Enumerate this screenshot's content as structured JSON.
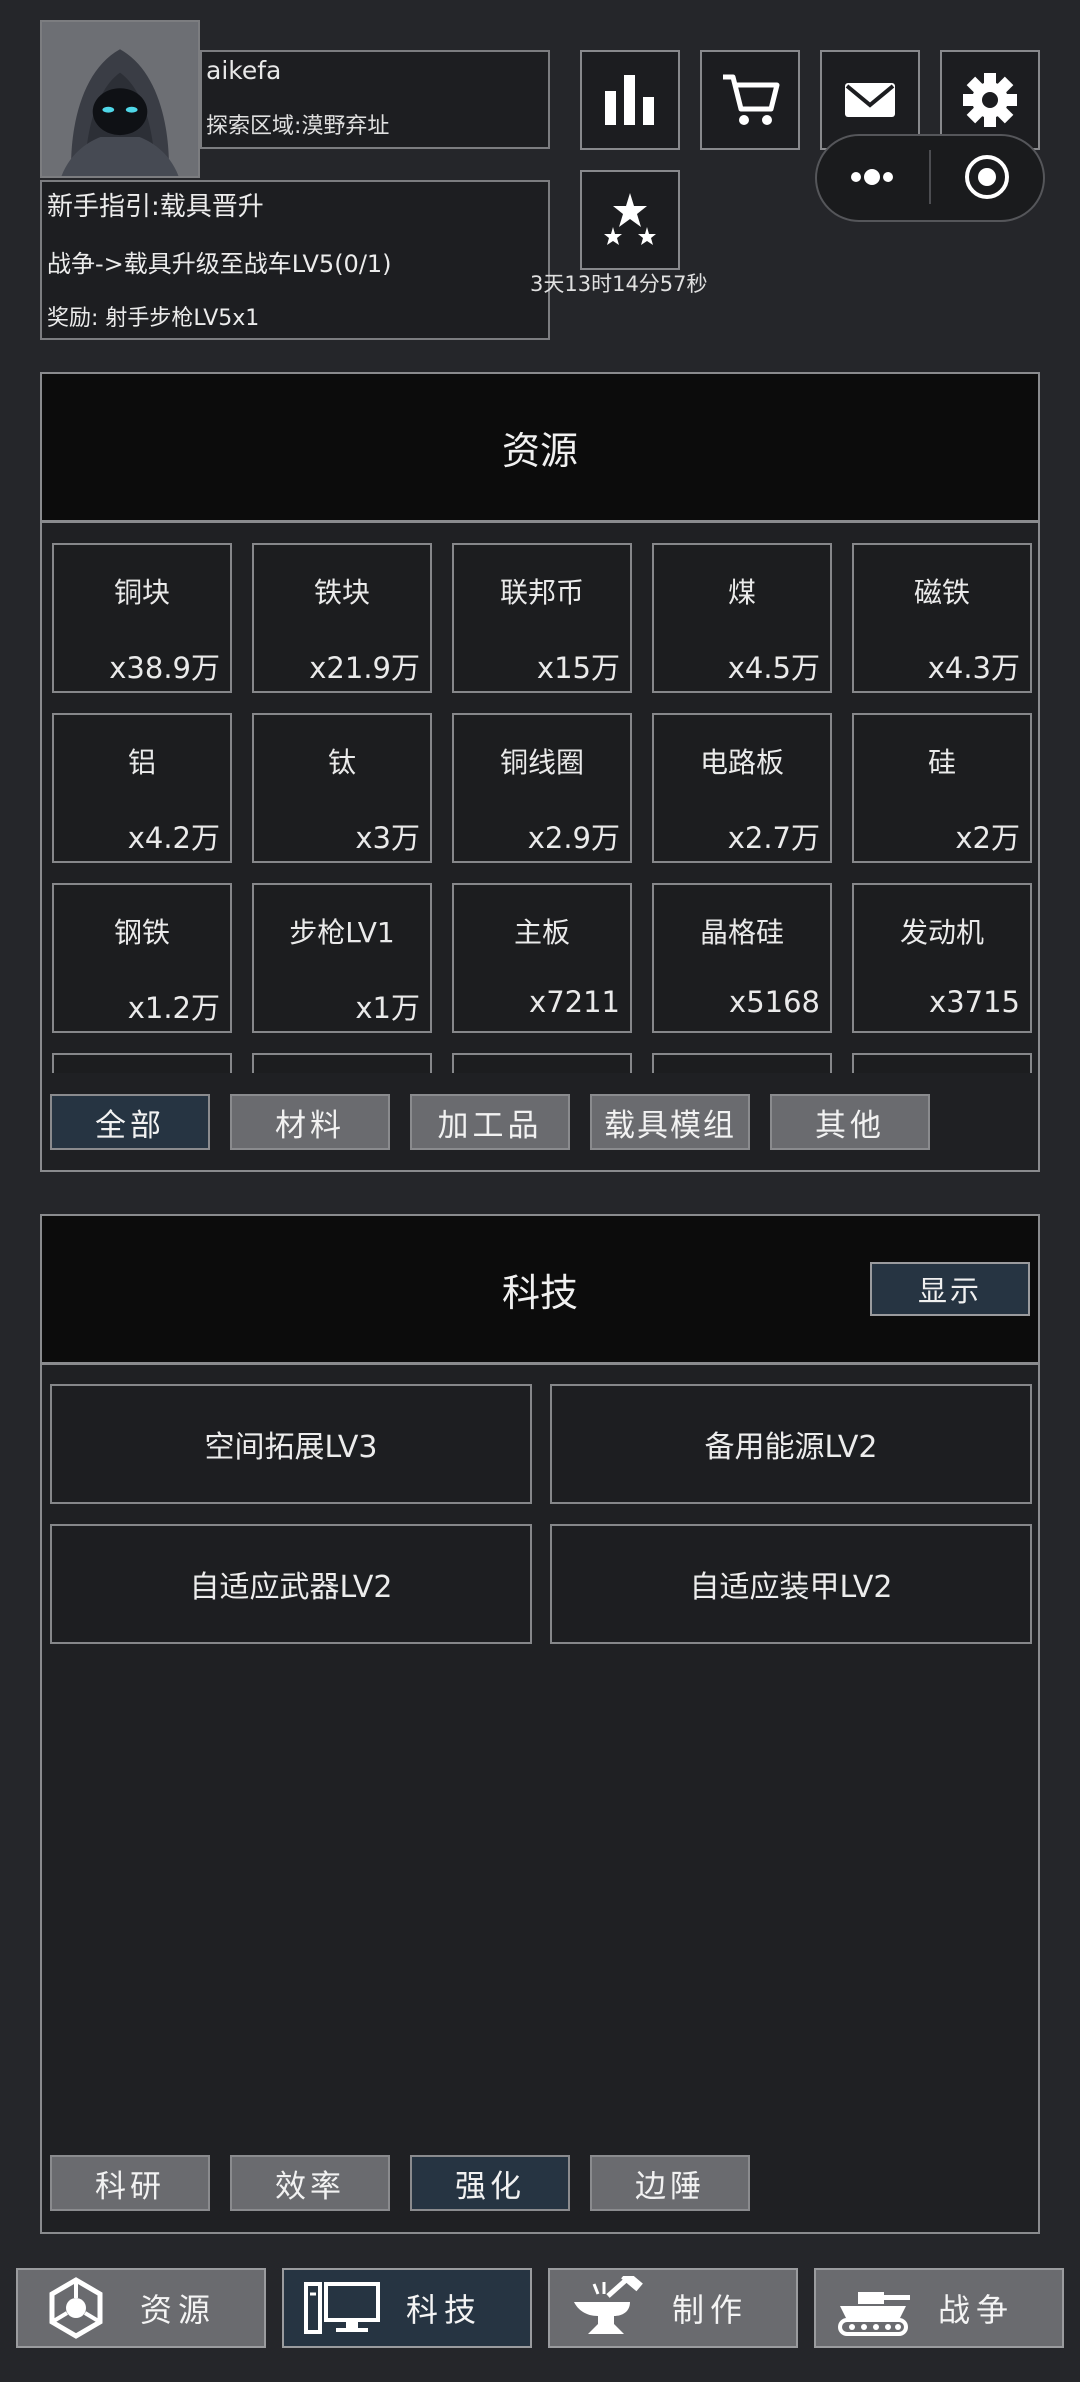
{
  "user": {
    "name": "aikefa",
    "area": "探索区域:漠野弃址"
  },
  "guide": {
    "title": "新手指引:载具晋升",
    "task": "战争->载具升级至战车LV5(0/1)",
    "reward": "奖励: 射手步枪LV5x1"
  },
  "timer": "3天13时14分57秒",
  "resources": {
    "title": "资源",
    "items": [
      {
        "name": "铜块",
        "count": "x38.9万"
      },
      {
        "name": "铁块",
        "count": "x21.9万"
      },
      {
        "name": "联邦币",
        "count": "x15万"
      },
      {
        "name": "煤",
        "count": "x4.5万"
      },
      {
        "name": "磁铁",
        "count": "x4.3万"
      },
      {
        "name": "铝",
        "count": "x4.2万"
      },
      {
        "name": "钛",
        "count": "x3万"
      },
      {
        "name": "铜线圈",
        "count": "x2.9万"
      },
      {
        "name": "电路板",
        "count": "x2.7万"
      },
      {
        "name": "硅",
        "count": "x2万"
      },
      {
        "name": "钢铁",
        "count": "x1.2万"
      },
      {
        "name": "步枪LV1",
        "count": "x1万"
      },
      {
        "name": "主板",
        "count": "x7211"
      },
      {
        "name": "晶格硅",
        "count": "x5168"
      },
      {
        "name": "发动机",
        "count": "x3715"
      }
    ],
    "filters": [
      "全部",
      "材料",
      "加工品",
      "载具模组",
      "其他"
    ]
  },
  "tech": {
    "title": "科技",
    "toggle_label": "显示",
    "items": [
      "空间拓展LV3",
      "备用能源LV2",
      "自适应武器LV2",
      "自适应装甲LV2"
    ],
    "filters": [
      "科研",
      "效率",
      "强化",
      "边陲"
    ]
  },
  "nav": [
    "资源",
    "科技",
    "制作",
    "战争"
  ],
  "icons": {
    "top_buttons": [
      "bar-chart-icon",
      "cart-icon",
      "mail-icon",
      "gear-icon",
      "stars-icon"
    ],
    "capsule": [
      "more-dots-icon",
      "record-icon"
    ]
  }
}
